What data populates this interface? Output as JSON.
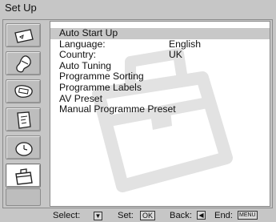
{
  "header": {
    "title": "Set Up"
  },
  "sidebar": {
    "items": [
      {
        "icon": "picture-icon"
      },
      {
        "icon": "sound-icon"
      },
      {
        "icon": "features-icon"
      },
      {
        "icon": "teletext-icon"
      },
      {
        "icon": "timer-icon"
      },
      {
        "icon": "setup-toolbox-icon",
        "active": true
      }
    ]
  },
  "menu": {
    "items": [
      {
        "label": "Auto Start Up",
        "value": ""
      },
      {
        "label": "Language:",
        "value": "English"
      },
      {
        "label": "Country:",
        "value": "UK"
      },
      {
        "label": "Auto Tuning",
        "value": ""
      },
      {
        "label": "Programme Sorting",
        "value": ""
      },
      {
        "label": "Programme Labels",
        "value": ""
      },
      {
        "label": "AV Preset",
        "value": ""
      },
      {
        "label": "Manual Programme Preset",
        "value": ""
      }
    ]
  },
  "footer": {
    "select_label": "Select:",
    "set_label": "Set:",
    "set_key": "OK",
    "back_label": "Back:",
    "end_label": "End:",
    "end_key": "MENU"
  },
  "colors": {
    "background": "#c6c6c6",
    "panel": "#ffffff",
    "highlight": "#c8c8c8"
  }
}
